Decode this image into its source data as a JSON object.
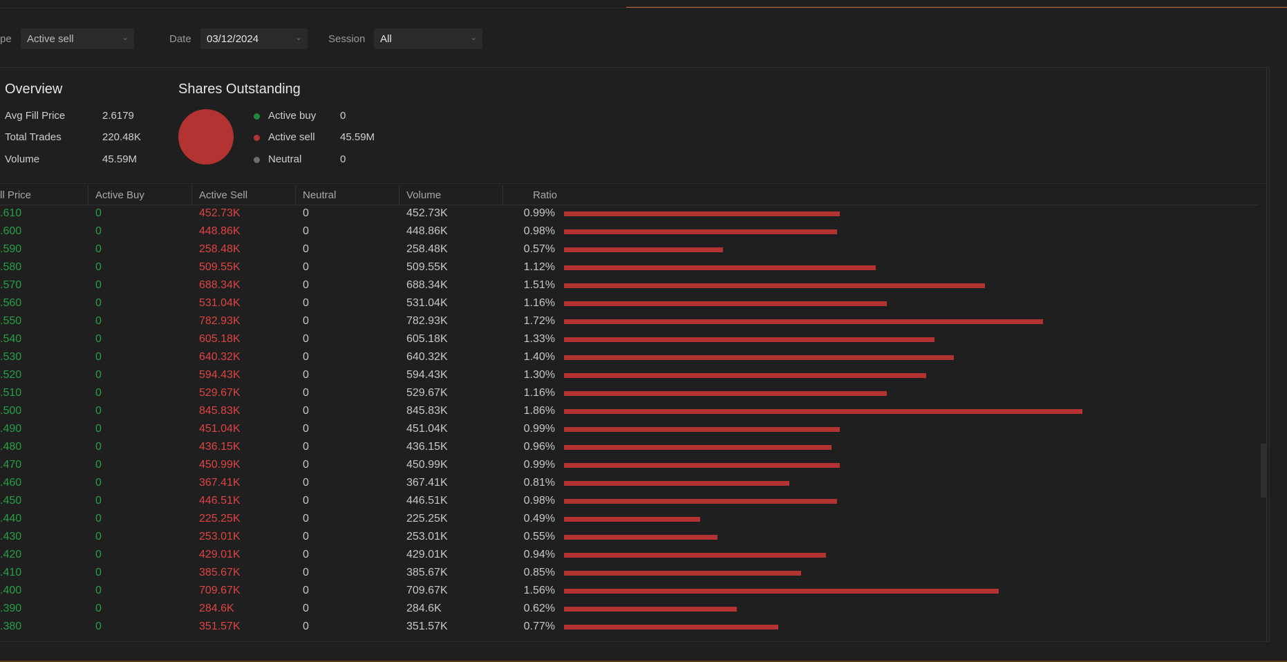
{
  "filters": {
    "type": {
      "label_partial": "pe",
      "value": "Active sell"
    },
    "date": {
      "label": "Date",
      "value": "03/12/2024"
    },
    "session": {
      "label": "Session",
      "value": "All"
    },
    "chevron_icon": "chevron-down"
  },
  "overview": {
    "title": "Overview",
    "items": [
      {
        "label": "Avg Fill Price",
        "value": "2.6179"
      },
      {
        "label": "Total Trades",
        "value": "220.48K"
      },
      {
        "label": "Volume",
        "value": "45.59M"
      }
    ]
  },
  "shares_outstanding": {
    "title": "Shares Outstanding",
    "legend": [
      {
        "label": "Active buy",
        "value": "0",
        "color": "#1f8a3e"
      },
      {
        "label": "Active sell",
        "value": "45.59M",
        "color": "#b33333"
      },
      {
        "label": "Neutral",
        "value": "0",
        "color": "#6b6d70"
      }
    ],
    "pie": [
      {
        "name": "Active buy",
        "value": 0
      },
      {
        "name": "Active sell",
        "value": 45.59
      },
      {
        "name": "Neutral",
        "value": 0
      }
    ]
  },
  "table": {
    "columns": [
      "ll Price",
      "Active Buy",
      "Active Sell",
      "Neutral",
      "Volume",
      "Ratio"
    ],
    "rows": [
      {
        "price": ".610",
        "buy": "0",
        "sell": "452.73K",
        "neutral": "0",
        "volume": "452.73K",
        "ratio": "0.99%",
        "ratio_value": 0.99
      },
      {
        "price": ".600",
        "buy": "0",
        "sell": "448.86K",
        "neutral": "0",
        "volume": "448.86K",
        "ratio": "0.98%",
        "ratio_value": 0.98
      },
      {
        "price": ".590",
        "buy": "0",
        "sell": "258.48K",
        "neutral": "0",
        "volume": "258.48K",
        "ratio": "0.57%",
        "ratio_value": 0.57
      },
      {
        "price": ".580",
        "buy": "0",
        "sell": "509.55K",
        "neutral": "0",
        "volume": "509.55K",
        "ratio": "1.12%",
        "ratio_value": 1.12
      },
      {
        "price": ".570",
        "buy": "0",
        "sell": "688.34K",
        "neutral": "0",
        "volume": "688.34K",
        "ratio": "1.51%",
        "ratio_value": 1.51
      },
      {
        "price": ".560",
        "buy": "0",
        "sell": "531.04K",
        "neutral": "0",
        "volume": "531.04K",
        "ratio": "1.16%",
        "ratio_value": 1.16
      },
      {
        "price": ".550",
        "buy": "0",
        "sell": "782.93K",
        "neutral": "0",
        "volume": "782.93K",
        "ratio": "1.72%",
        "ratio_value": 1.72
      },
      {
        "price": ".540",
        "buy": "0",
        "sell": "605.18K",
        "neutral": "0",
        "volume": "605.18K",
        "ratio": "1.33%",
        "ratio_value": 1.33
      },
      {
        "price": ".530",
        "buy": "0",
        "sell": "640.32K",
        "neutral": "0",
        "volume": "640.32K",
        "ratio": "1.40%",
        "ratio_value": 1.4
      },
      {
        "price": ".520",
        "buy": "0",
        "sell": "594.43K",
        "neutral": "0",
        "volume": "594.43K",
        "ratio": "1.30%",
        "ratio_value": 1.3
      },
      {
        "price": ".510",
        "buy": "0",
        "sell": "529.67K",
        "neutral": "0",
        "volume": "529.67K",
        "ratio": "1.16%",
        "ratio_value": 1.16
      },
      {
        "price": ".500",
        "buy": "0",
        "sell": "845.83K",
        "neutral": "0",
        "volume": "845.83K",
        "ratio": "1.86%",
        "ratio_value": 1.86
      },
      {
        "price": ".490",
        "buy": "0",
        "sell": "451.04K",
        "neutral": "0",
        "volume": "451.04K",
        "ratio": "0.99%",
        "ratio_value": 0.99
      },
      {
        "price": ".480",
        "buy": "0",
        "sell": "436.15K",
        "neutral": "0",
        "volume": "436.15K",
        "ratio": "0.96%",
        "ratio_value": 0.96
      },
      {
        "price": ".470",
        "buy": "0",
        "sell": "450.99K",
        "neutral": "0",
        "volume": "450.99K",
        "ratio": "0.99%",
        "ratio_value": 0.99
      },
      {
        "price": ".460",
        "buy": "0",
        "sell": "367.41K",
        "neutral": "0",
        "volume": "367.41K",
        "ratio": "0.81%",
        "ratio_value": 0.81
      },
      {
        "price": ".450",
        "buy": "0",
        "sell": "446.51K",
        "neutral": "0",
        "volume": "446.51K",
        "ratio": "0.98%",
        "ratio_value": 0.98
      },
      {
        "price": ".440",
        "buy": "0",
        "sell": "225.25K",
        "neutral": "0",
        "volume": "225.25K",
        "ratio": "0.49%",
        "ratio_value": 0.49
      },
      {
        "price": ".430",
        "buy": "0",
        "sell": "253.01K",
        "neutral": "0",
        "volume": "253.01K",
        "ratio": "0.55%",
        "ratio_value": 0.55
      },
      {
        "price": ".420",
        "buy": "0",
        "sell": "429.01K",
        "neutral": "0",
        "volume": "429.01K",
        "ratio": "0.94%",
        "ratio_value": 0.94
      },
      {
        "price": ".410",
        "buy": "0",
        "sell": "385.67K",
        "neutral": "0",
        "volume": "385.67K",
        "ratio": "0.85%",
        "ratio_value": 0.85
      },
      {
        "price": ".400",
        "buy": "0",
        "sell": "709.67K",
        "neutral": "0",
        "volume": "709.67K",
        "ratio": "1.56%",
        "ratio_value": 1.56
      },
      {
        "price": ".390",
        "buy": "0",
        "sell": "284.6K",
        "neutral": "0",
        "volume": "284.6K",
        "ratio": "0.62%",
        "ratio_value": 0.62
      },
      {
        "price": ".380",
        "buy": "0",
        "sell": "351.57K",
        "neutral": "0",
        "volume": "351.57K",
        "ratio": "0.77%",
        "ratio_value": 0.77
      }
    ],
    "bar_color": "#b33333"
  }
}
